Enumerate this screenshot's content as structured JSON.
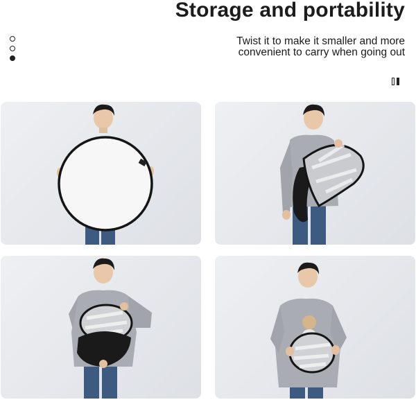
{
  "header": {
    "title": "Storage and portability",
    "subtitle_lines": [
      "Twist it to make it smaller and more",
      "convenient to carry when going out"
    ]
  },
  "colors": {
    "background": "#ffffff",
    "text": "#1a1a1a",
    "panel_background": "#e4e7eb",
    "sweater": "#a9acb2",
    "jeans": "#3d5a80",
    "reflector_frame": "#151515"
  },
  "photos": [
    {
      "id": "step-1",
      "description_icon": "person-holding-open-reflector-icon"
    },
    {
      "id": "step-2",
      "description_icon": "person-folding-reflector-icon"
    },
    {
      "id": "step-3",
      "description_icon": "person-twisting-reflector-icon"
    },
    {
      "id": "step-4",
      "description_icon": "person-holding-folded-reflector-icon"
    }
  ]
}
